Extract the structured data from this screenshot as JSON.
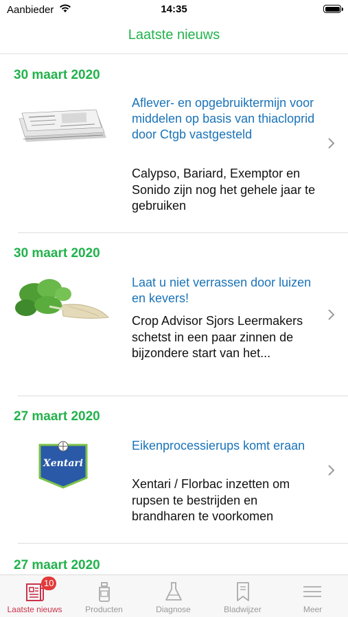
{
  "status_bar": {
    "carrier": "Aanbieder",
    "time": "14:35"
  },
  "nav": {
    "title": "Laatste nieuws"
  },
  "news": [
    {
      "date": "30 maart 2020",
      "headline": "Aflever- en opgebruiktermijn voor middelen op basis van thiacloprid door Ctgb vastgesteld",
      "summary": "Calypso, Bariard, Exemptor en Sonido zijn nog het gehele jaar te gebruiken",
      "image": "newspapers"
    },
    {
      "date": "30 maart 2020",
      "headline": "Laat u niet verrassen door luizen en kevers!",
      "summary": "Crop Advisor Sjors Leermakers schetst in een paar zinnen de bijzondere start van het...",
      "image": "sugar-beet"
    },
    {
      "date": "27 maart 2020",
      "headline": "Eikenprocessierups komt eraan",
      "summary": "Xentari / Florbac inzetten om rupsen te bestrijden en brandharen te voorkomen",
      "image": "xentari-logo",
      "logo_text": "Xentari"
    },
    {
      "date": "27 maart 2020"
    }
  ],
  "tabs": [
    {
      "label": "Laatste nieuws",
      "icon": "news-icon",
      "badge": "10",
      "active": true
    },
    {
      "label": "Producten",
      "icon": "bottle-icon"
    },
    {
      "label": "Diagnose",
      "icon": "flask-icon"
    },
    {
      "label": "Bladwijzer",
      "icon": "bookmark-icon"
    },
    {
      "label": "Meer",
      "icon": "menu-icon"
    }
  ],
  "colors": {
    "accent": "#22b24c",
    "link": "#1a73b8",
    "active_tab": "#c9334a",
    "badge": "#e23a3a"
  }
}
